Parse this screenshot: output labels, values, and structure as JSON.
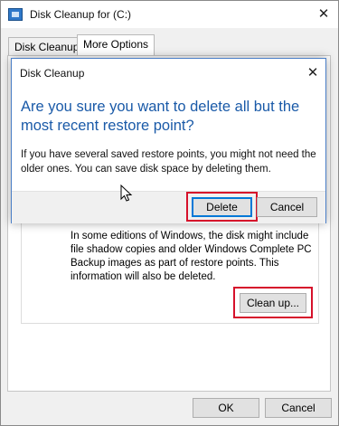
{
  "window": {
    "title": "Disk Cleanup for  (C:)",
    "close_glyph": "✕",
    "app_icon": "disk-cleanup-icon"
  },
  "tabs": [
    {
      "label": "Disk Cleanup",
      "active": false
    },
    {
      "label": "More Options",
      "active": true
    }
  ],
  "section": {
    "description": "In some editions of Windows, the disk might include file shadow copies and older Windows Complete PC Backup images as part of restore points. This information will also be deleted.",
    "cleanup_button": "Clean up..."
  },
  "footer": {
    "ok_label": "OK",
    "cancel_label": "Cancel"
  },
  "dialog": {
    "title": "Disk Cleanup",
    "close_glyph": "✕",
    "heading": "Are you sure you want to delete all but the most recent restore point?",
    "body": "If you have several saved restore points, you might not need the older ones. You can save disk space by deleting them.",
    "delete_label": "Delete",
    "cancel_label": "Cancel"
  },
  "colors": {
    "heading_blue": "#1a5aa8",
    "highlight_red": "#d6112b",
    "focus_blue": "#0078d7"
  }
}
